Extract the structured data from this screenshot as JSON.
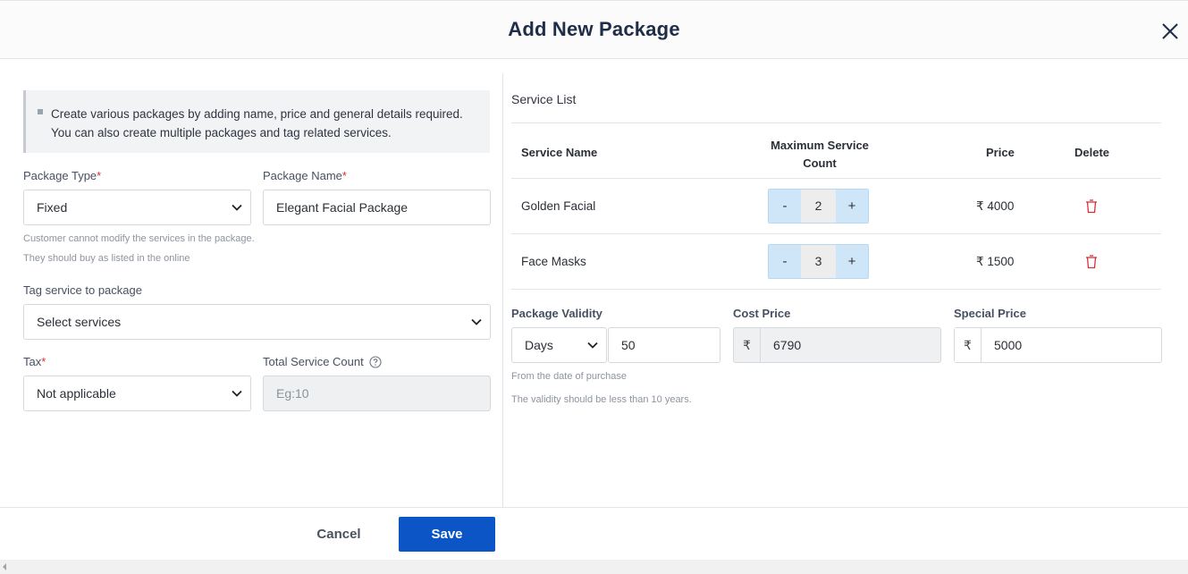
{
  "header": {
    "title": "Add New Package"
  },
  "info": {
    "text": "Create various packages by adding name, price and general details required. You can also create multiple packages and tag related services."
  },
  "form": {
    "package_type": {
      "label": "Package Type",
      "required": "*",
      "value": "Fixed"
    },
    "package_name": {
      "label": "Package Name",
      "required": "*",
      "value": "Elegant Facial Package"
    },
    "hints": [
      "Customer cannot modify the services in the package.",
      "They should buy as listed in the online"
    ],
    "tag_service": {
      "label": "Tag service to package",
      "value": "Select services"
    },
    "tax": {
      "label": "Tax",
      "required": "*",
      "value": "Not applicable"
    },
    "total_service_count": {
      "label": "Total Service Count",
      "placeholder": "Eg:10"
    }
  },
  "service_list": {
    "title": "Service List",
    "headers": {
      "name": "Service Name",
      "max_count_line1": "Maximum Service",
      "max_count_line2": "Count",
      "price": "Price",
      "delete": "Delete"
    },
    "rows": [
      {
        "name": "Golden Facial",
        "count": "2",
        "price": "₹ 4000",
        "minus": "-",
        "plus": "+"
      },
      {
        "name": "Face Masks",
        "count": "3",
        "price": "₹ 1500",
        "minus": "-",
        "plus": "+"
      }
    ]
  },
  "validity": {
    "label": "Package Validity",
    "unit": "Days",
    "value": "50",
    "hint1": "From the date of purchase",
    "hint2": "The validity should be less than 10 years."
  },
  "cost_price": {
    "label": "Cost Price",
    "symbol": "₹",
    "value": "6790"
  },
  "special_price": {
    "label": "Special Price",
    "symbol": "₹",
    "value": "5000"
  },
  "footer": {
    "cancel": "Cancel",
    "save": "Save"
  },
  "colors": {
    "primary": "#0b55c7",
    "stepper": "#cfe6f8",
    "danger": "#d6303a"
  }
}
